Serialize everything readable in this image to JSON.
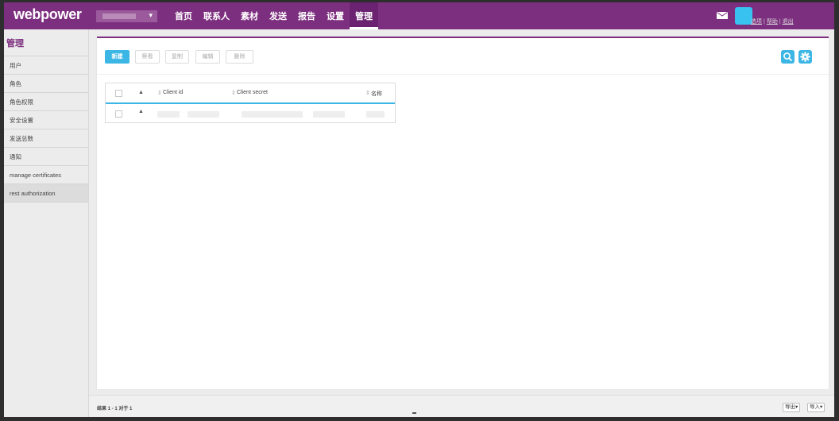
{
  "header": {
    "logo": "webpower",
    "account_caret": "▾",
    "nav": [
      "首页",
      "联系人",
      "素材",
      "发送",
      "报告",
      "设置",
      "管理"
    ],
    "active_nav": "管理",
    "links": [
      "选项",
      "帮助",
      "退出"
    ]
  },
  "sidebar": {
    "title": "管理",
    "items": [
      "用户",
      "角色",
      "角色权限",
      "安全设置",
      "发送总数",
      "通知",
      "manage certificates",
      "rest authorization"
    ],
    "active_item": "rest authorization"
  },
  "toolbar": {
    "new_label": "新建",
    "view_label": "察看",
    "copy_label": "复制",
    "edit_label": "编辑",
    "delete_label": "删除"
  },
  "table": {
    "columns": [
      "Client id",
      "Client secret",
      "名称"
    ],
    "sort_indicator": "⇕",
    "bell_icon_glyph": "▲"
  },
  "footer": {
    "result_text": "结果 1 - 1 对于 1",
    "export_label": "导出",
    "import_label": "导入",
    "caret": "▾"
  },
  "colors": {
    "brand_purple": "#7d2f7f",
    "accent_blue": "#3cb6e5"
  },
  "icons": [
    "mail-icon",
    "search-icon",
    "gear-icon",
    "bell-icon",
    "chevron-down-icon"
  ]
}
